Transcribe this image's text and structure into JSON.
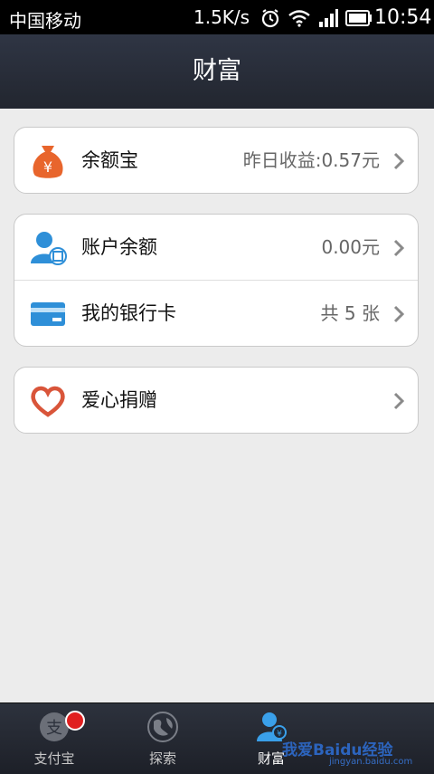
{
  "status_bar": {
    "carrier": "中国移动",
    "speed": "1.5K/s",
    "time": "10:54"
  },
  "header": {
    "title": "财富"
  },
  "card1": {
    "rows": [
      {
        "label": "余额宝",
        "value": "昨日收益:0.57元",
        "icon": "money-bag-icon"
      }
    ]
  },
  "card2": {
    "rows": [
      {
        "label": "账户余额",
        "value": "0.00元",
        "icon": "account-user-icon"
      },
      {
        "label": "我的银行卡",
        "value": "共 5 张",
        "icon": "bank-card-icon"
      }
    ]
  },
  "card3": {
    "rows": [
      {
        "label": "爱心捐赠",
        "value": "",
        "icon": "heart-icon"
      }
    ]
  },
  "tabbar": {
    "tabs": [
      {
        "label": "支付宝",
        "icon": "alipay-icon",
        "badge": true
      },
      {
        "label": "探索",
        "icon": "globe-icon"
      },
      {
        "label": "财富",
        "icon": "wealth-icon",
        "active": true
      }
    ]
  },
  "watermark": {
    "main": "我爱Baidu经验",
    "sub": "jingyan.baidu.com"
  },
  "colors": {
    "header_bg": "#2f3544",
    "page_bg": "#ececec",
    "badge": "#e02020",
    "yuebao_orange": "#e8652c",
    "account_blue": "#2e8fd8",
    "heart_red": "#d9553a"
  }
}
